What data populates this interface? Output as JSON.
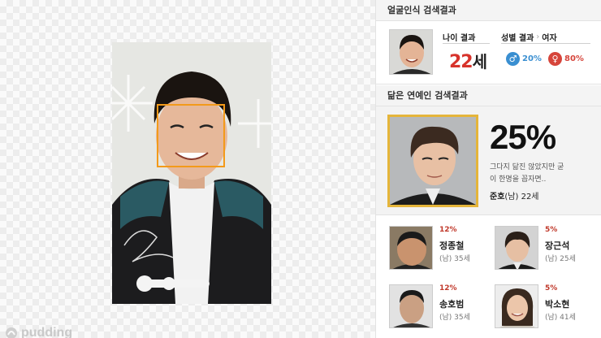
{
  "brand": {
    "name": "pudding"
  },
  "age_section": {
    "title": "얼굴인식 검색결과",
    "age_label": "나이 결과",
    "age_value": "22",
    "age_unit": "세",
    "gender_label": "성별 결과",
    "gender_result": "여자",
    "male_pct": "20%",
    "female_pct": "80%",
    "colors": {
      "male": "#3a8fd1",
      "female": "#d6453b",
      "accent": "#d7332b"
    }
  },
  "similar_section": {
    "title": "닮은 연예인 검색결과",
    "best": {
      "pct": "25%",
      "desc_line1": "그다지 닮진 않았지만 굳",
      "desc_line2": "이 한명을 꼽자면..",
      "name": "준호",
      "info": "(남) 22세"
    },
    "others": [
      {
        "pct": "12%",
        "name": "정종철",
        "info": "(남) 35세"
      },
      {
        "pct": "5%",
        "name": "장근석",
        "info": "(남) 25세"
      },
      {
        "pct": "12%",
        "name": "송호범",
        "info": "(남) 35세"
      },
      {
        "pct": "5%",
        "name": "박소현",
        "info": "(남) 41세"
      }
    ]
  }
}
